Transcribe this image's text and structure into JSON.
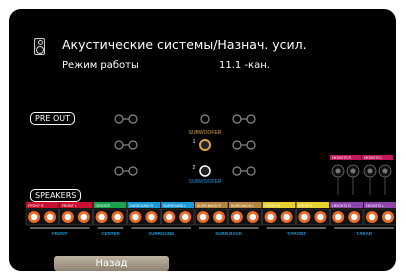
{
  "header": {
    "title": "Акустические системы/Назнач. усил.",
    "icon": "speaker-icon"
  },
  "mode": {
    "label": "Режим работы",
    "value": "11.1 -кан."
  },
  "pre_out": {
    "label": "PRE OUT",
    "subwoofer_label": "SUBWOOFER",
    "sub1_number": "1",
    "sub2_number": "2"
  },
  "speakers": {
    "label": "SPEAKERS",
    "terminals": [
      {
        "label": "FRONT",
        "number": "R",
        "color": "#c8102e"
      },
      {
        "label": "FRONT",
        "number": "L",
        "color": "#c8102e"
      },
      {
        "label": "CENTER",
        "number": "",
        "color": "#1aa34a"
      },
      {
        "label": "SURROUND",
        "number": "R",
        "color": "#1a9ad6"
      },
      {
        "label": "SURROUND",
        "number": "L",
        "color": "#1a9ad6"
      },
      {
        "label": "SURR.BACK",
        "number": "R",
        "color": "#b8863a"
      },
      {
        "label": "SURR.BACK",
        "number": "L",
        "color": "#b8863a"
      },
      {
        "label": "FRONT",
        "number": "R",
        "color": "#e6d12e"
      },
      {
        "label": "FRONT",
        "number": "L",
        "color": "#e6d12e"
      },
      {
        "label": "HEIGHT2",
        "number": "R",
        "color": "#8e44ad"
      },
      {
        "label": "HEIGHT2",
        "number": "L",
        "color": "#8e44ad"
      }
    ],
    "heights_top": [
      {
        "label": "HEIGHTS",
        "number": "R",
        "color": "#c2185b"
      },
      {
        "label": "HEIGHTS",
        "number": "L",
        "color": "#c2185b"
      }
    ],
    "bottom_labels": [
      "FRONT",
      "CENTER",
      "SURROUND",
      "SURR.BACK",
      "T.FRONT",
      "T.REAR"
    ]
  },
  "back_button": {
    "label": "Назад"
  }
}
